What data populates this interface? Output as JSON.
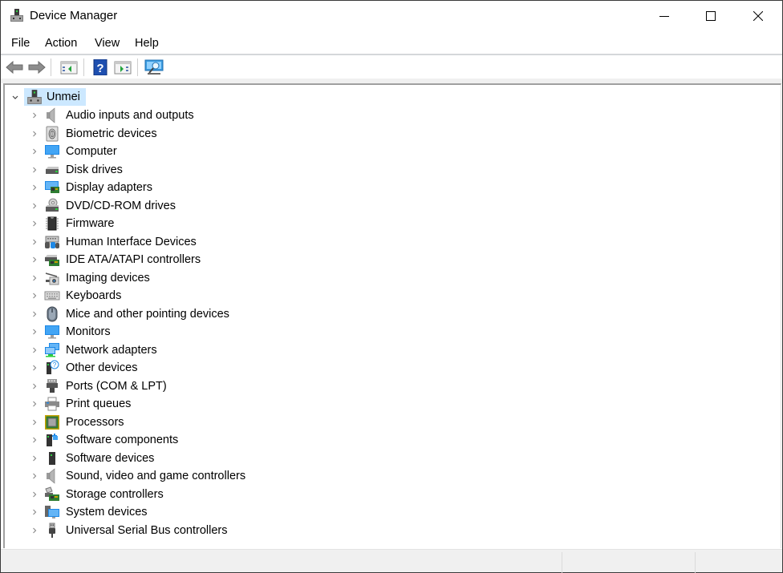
{
  "window": {
    "title": "Device Manager",
    "controls": {
      "minimize": "minimize",
      "maximize": "maximize",
      "close": "close"
    }
  },
  "menubar": {
    "items": [
      {
        "label": "File"
      },
      {
        "label": "Action"
      },
      {
        "label": "View"
      },
      {
        "label": "Help"
      }
    ]
  },
  "toolbar": {
    "buttons": [
      {
        "name": "back",
        "icon": "back-arrow-icon"
      },
      {
        "name": "forward",
        "icon": "forward-arrow-icon"
      },
      {
        "name": "show-hide-console-tree",
        "icon": "console-tree-icon"
      },
      {
        "name": "help",
        "icon": "help-icon",
        "glyph": "?"
      },
      {
        "name": "show-hide-action-pane",
        "icon": "action-pane-icon"
      },
      {
        "name": "scan-hardware",
        "icon": "scan-hardware-icon"
      }
    ]
  },
  "tree": {
    "root": {
      "label": "Unmei",
      "expanded": true,
      "selected": true,
      "icon": "computer-tower-icon"
    },
    "items": [
      {
        "label": "Audio inputs and outputs",
        "icon": "speaker-icon"
      },
      {
        "label": "Biometric devices",
        "icon": "fingerprint-icon"
      },
      {
        "label": "Computer",
        "icon": "monitor-icon"
      },
      {
        "label": "Disk drives",
        "icon": "disk-drive-icon"
      },
      {
        "label": "Display adapters",
        "icon": "display-adapter-icon"
      },
      {
        "label": "DVD/CD-ROM drives",
        "icon": "dvd-drive-icon"
      },
      {
        "label": "Firmware",
        "icon": "chip-icon"
      },
      {
        "label": "Human Interface Devices",
        "icon": "hid-icon"
      },
      {
        "label": "IDE ATA/ATAPI controllers",
        "icon": "ide-controller-icon"
      },
      {
        "label": "Imaging devices",
        "icon": "camera-icon"
      },
      {
        "label": "Keyboards",
        "icon": "keyboard-icon"
      },
      {
        "label": "Mice and other pointing devices",
        "icon": "mouse-icon"
      },
      {
        "label": "Monitors",
        "icon": "monitor-icon"
      },
      {
        "label": "Network adapters",
        "icon": "network-icon"
      },
      {
        "label": "Other devices",
        "icon": "unknown-device-icon"
      },
      {
        "label": "Ports (COM & LPT)",
        "icon": "port-icon"
      },
      {
        "label": "Print queues",
        "icon": "printer-icon"
      },
      {
        "label": "Processors",
        "icon": "processor-icon"
      },
      {
        "label": "Software components",
        "icon": "software-component-icon"
      },
      {
        "label": "Software devices",
        "icon": "software-device-icon"
      },
      {
        "label": "Sound, video and game controllers",
        "icon": "speaker-icon"
      },
      {
        "label": "Storage controllers",
        "icon": "storage-controller-icon"
      },
      {
        "label": "System devices",
        "icon": "system-devices-icon"
      },
      {
        "label": "Universal Serial Bus controllers",
        "icon": "usb-icon"
      }
    ]
  },
  "statusbar": {
    "panes": [
      "",
      "",
      ""
    ]
  },
  "colors": {
    "selection": "#cce8ff",
    "statusbar": "#f0f0f0",
    "accent_blue": "#1e88e5"
  }
}
